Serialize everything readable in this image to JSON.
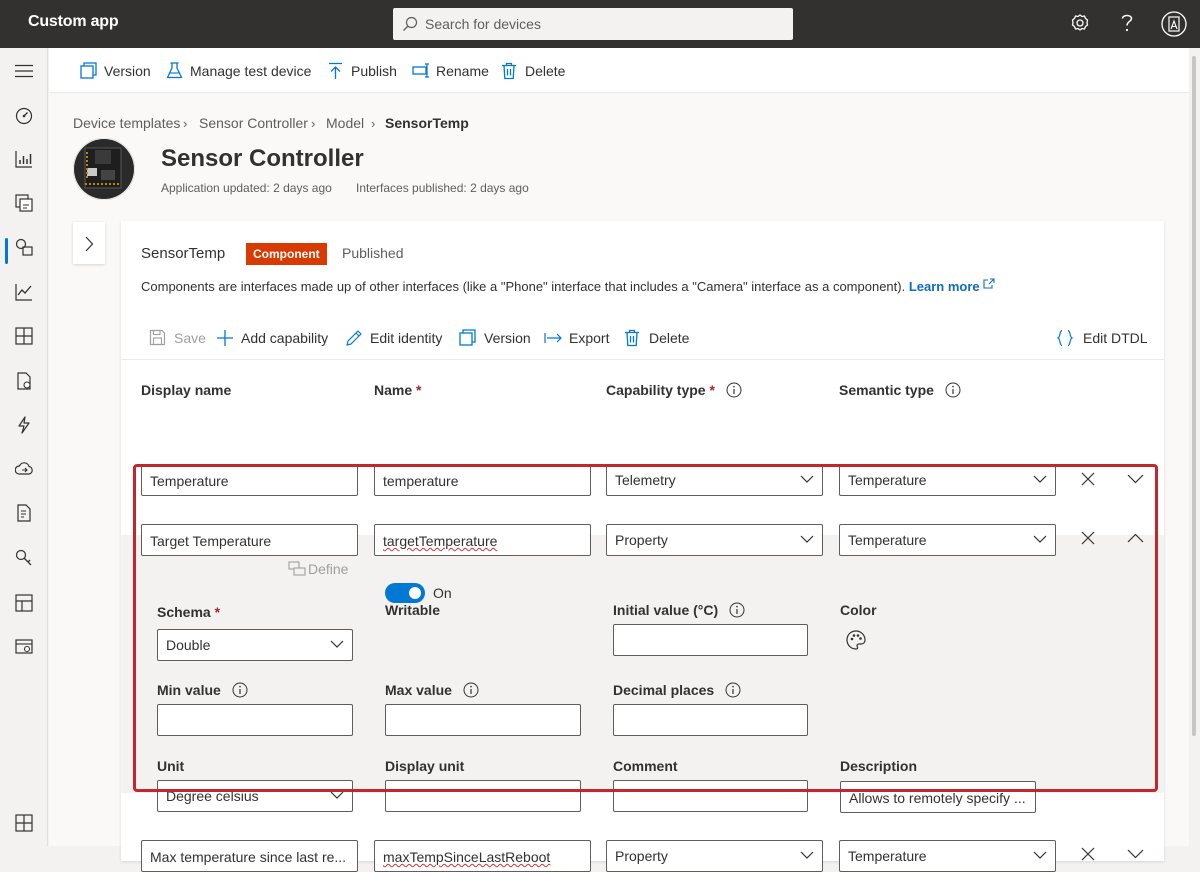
{
  "app": {
    "title": "Custom app"
  },
  "search": {
    "placeholder": "Search for devices"
  },
  "command_bar": {
    "version": "Version",
    "manage_test_device": "Manage test device",
    "publish": "Publish",
    "rename": "Rename",
    "delete": "Delete"
  },
  "breadcrumb": [
    "Device templates",
    "Sensor Controller",
    "Model",
    "SensorTemp"
  ],
  "header": {
    "title": "Sensor Controller",
    "app_updated": "Application updated: 2 days ago",
    "interfaces_published": "Interfaces published: 2 days ago"
  },
  "card": {
    "title": "SensorTemp",
    "badge": "Component",
    "status": "Published",
    "description": "Components are interfaces made up of other interfaces (like a \"Phone\" interface that includes a \"Camera\" interface as a component).",
    "learn_more": "Learn more"
  },
  "toolbar": {
    "save": "Save",
    "add_capability": "Add capability",
    "edit_identity": "Edit identity",
    "version": "Version",
    "export": "Export",
    "delete": "Delete",
    "edit_dtdl": "Edit DTDL"
  },
  "columns": {
    "display_name": "Display name",
    "name": "Name",
    "capability_type": "Capability type",
    "semantic_type": "Semantic type",
    "required_mark": "*"
  },
  "rows": [
    {
      "display_name": "Temperature",
      "name": "temperature",
      "capability_type": "Telemetry",
      "semantic_type": "Temperature"
    },
    {
      "display_name": "Target Temperature",
      "name": "targetTemperature",
      "capability_type": "Property",
      "semantic_type": "Temperature"
    },
    {
      "display_name": "Max temperature since last re...",
      "name": "maxTempSinceLastReboot",
      "capability_type": "Property",
      "semantic_type": "Temperature"
    }
  ],
  "details": {
    "schema_label": "Schema",
    "schema_value": "Double",
    "define": "Define",
    "writable_label": "Writable",
    "writable_state": "On",
    "initial_value_label": "Initial value (°C)",
    "initial_value": "",
    "color_label": "Color",
    "min_value_label": "Min value",
    "min_value": "",
    "max_value_label": "Max value",
    "max_value": "",
    "decimal_places_label": "Decimal places",
    "decimal_places": "",
    "unit_label": "Unit",
    "unit_value": "Degree celsius",
    "display_unit_label": "Display unit",
    "display_unit": "",
    "comment_label": "Comment",
    "comment": "",
    "description_label": "Description",
    "description_value": "Allows to remotely specify ..."
  },
  "colors": {
    "topbar": "#323130",
    "accent": "#0078d4",
    "badge": "#d83b01",
    "highlight": "#c4262e",
    "link": "#0f6cbd"
  }
}
